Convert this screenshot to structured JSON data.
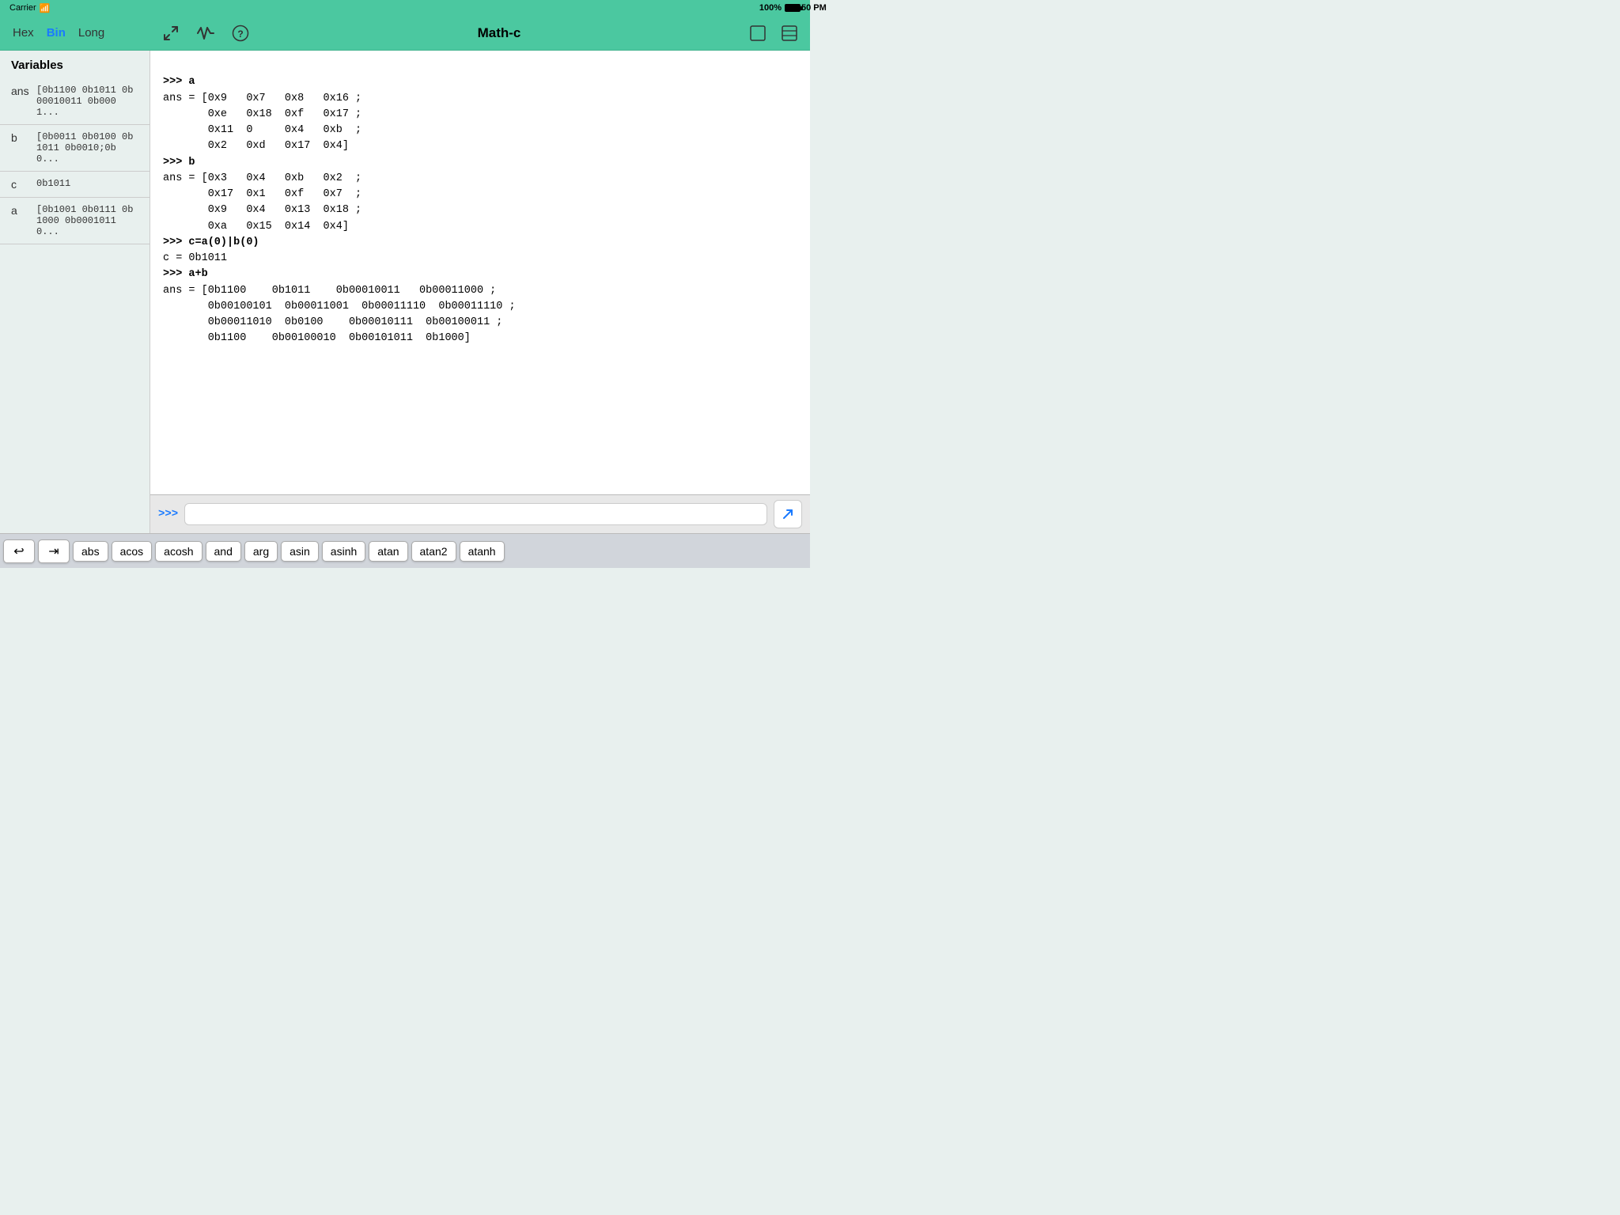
{
  "statusBar": {
    "carrier": "Carrier",
    "wifi": "wifi",
    "time": "7:50 PM",
    "battery": "100%"
  },
  "toolbar": {
    "title": "Math-c",
    "formatHex": "Hex",
    "formatBin": "Bin",
    "formatLong": "Long",
    "activeFormat": "Bin"
  },
  "variables": {
    "header": "Variables",
    "items": [
      {
        "name": "ans",
        "value": "[0b1100 0b1011 0b00010011 0b0001..."
      },
      {
        "name": "b",
        "value": "[0b0011 0b0100 0b1011 0b0010;0b0..."
      },
      {
        "name": "c",
        "value": "0b1011"
      },
      {
        "name": "a",
        "value": "[0b1001 0b0111 0b1000 0b00010110..."
      }
    ]
  },
  "console": {
    "lines": [
      ">>> a",
      "ans = [0x9   0x7   0x8   0x16 ;",
      "       0xe   0x18  0xf   0x17 ;",
      "       0x11  0     0x4   0xb  ;",
      "       0x2   0xd   0x17  0x4]",
      ">>> b",
      "ans = [0x3   0x4   0xb   0x2  ;",
      "       0x17  0x1   0xf   0x7  ;",
      "       0x9   0x4   0x13  0x18 ;",
      "       0xa   0x15  0x14  0x4]",
      ">>> c=a(0)|b(0)",
      "c = 0b1011",
      ">>> a+b",
      "ans = [0b1100    0b1011    0b00010011   0b00011000 ;",
      "       0b00100101  0b00011001  0b00011110  0b00011110 ;",
      "       0b00011010  0b0100    0b00010111  0b00100011 ;",
      "       0b1100    0b00100010  0b00101011  0b1000]"
    ],
    "prompt": ">>>",
    "inputPlaceholder": ""
  },
  "keyboardBar": {
    "buttons": [
      {
        "label": "↩",
        "isIcon": true
      },
      {
        "label": "→",
        "isIcon": true
      },
      {
        "label": "abs",
        "isIcon": false
      },
      {
        "label": "acos",
        "isIcon": false
      },
      {
        "label": "acosh",
        "isIcon": false
      },
      {
        "label": "and",
        "isIcon": false
      },
      {
        "label": "arg",
        "isIcon": false
      },
      {
        "label": "asin",
        "isIcon": false
      },
      {
        "label": "asinh",
        "isIcon": false
      },
      {
        "label": "atan",
        "isIcon": false
      },
      {
        "label": "atan2",
        "isIcon": false
      },
      {
        "label": "atanh",
        "isIcon": false
      }
    ]
  }
}
